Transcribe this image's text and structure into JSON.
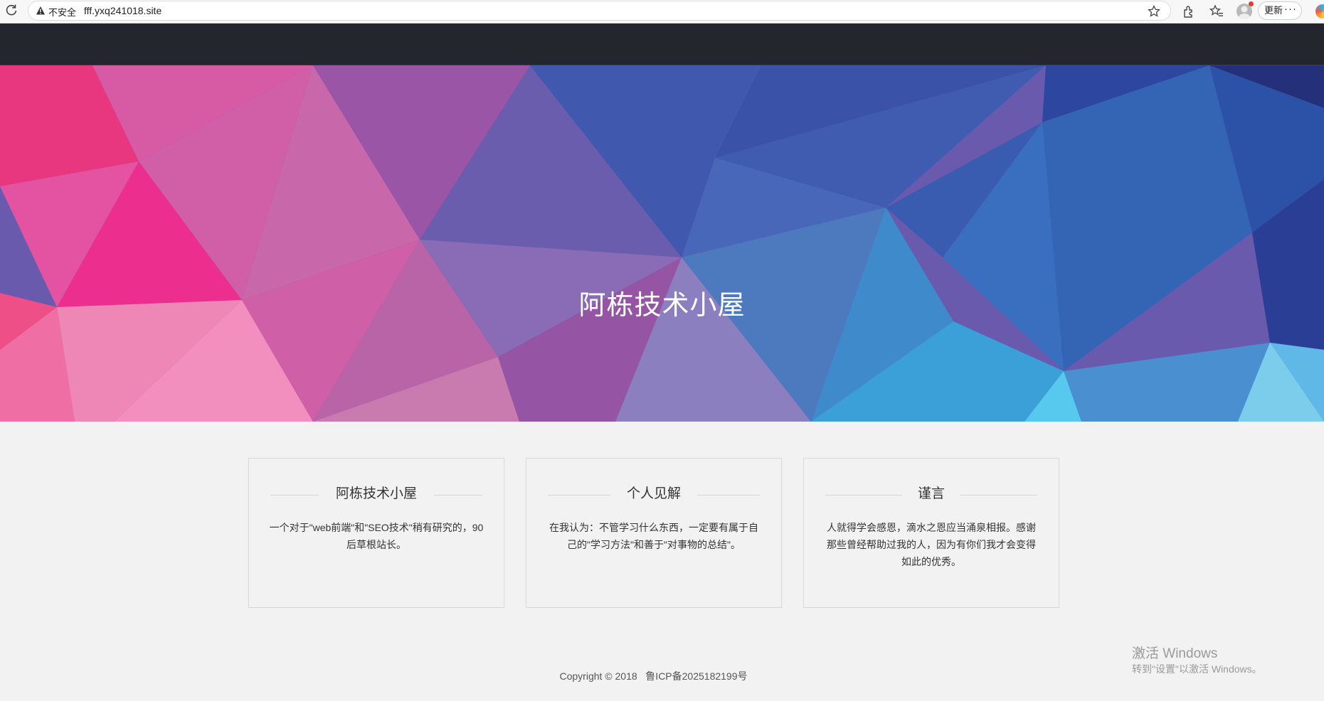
{
  "browser": {
    "security_label": "不安全",
    "url": "fff.yxq241018.site",
    "update_label": "更新",
    "more_label": "···"
  },
  "hero": {
    "title": "阿栋技术小屋"
  },
  "cards": [
    {
      "title": "阿栋技术小屋",
      "text": "一个对于\"web前端\"和\"SEO技术\"稍有研究的，90后草根站长。"
    },
    {
      "title": "个人见解",
      "text": "在我认为：不管学习什么东西，一定要有属于自己的\"学习方法\"和善于\"对事物的总结\"。"
    },
    {
      "title": "谨言",
      "text": "人就得学会感恩，滴水之恩应当涌泉相报。感谢那些曾经帮助过我的人，因为有你们我才会变得如此的优秀。"
    }
  ],
  "footer": {
    "text": "Copyright © 2018   鲁ICP备2025182199号"
  },
  "watermark": {
    "title": "激活 Windows",
    "subtitle": "转到\"设置\"以激活 Windows。"
  },
  "colors": {
    "nav_bg": "#23262d",
    "page_bg": "#f2f2f2",
    "hero_pink": "#ee3f8f",
    "hero_purple": "#8e5aa8",
    "hero_blue": "#3a5ab0",
    "hero_cyan": "#4cc6ea"
  }
}
